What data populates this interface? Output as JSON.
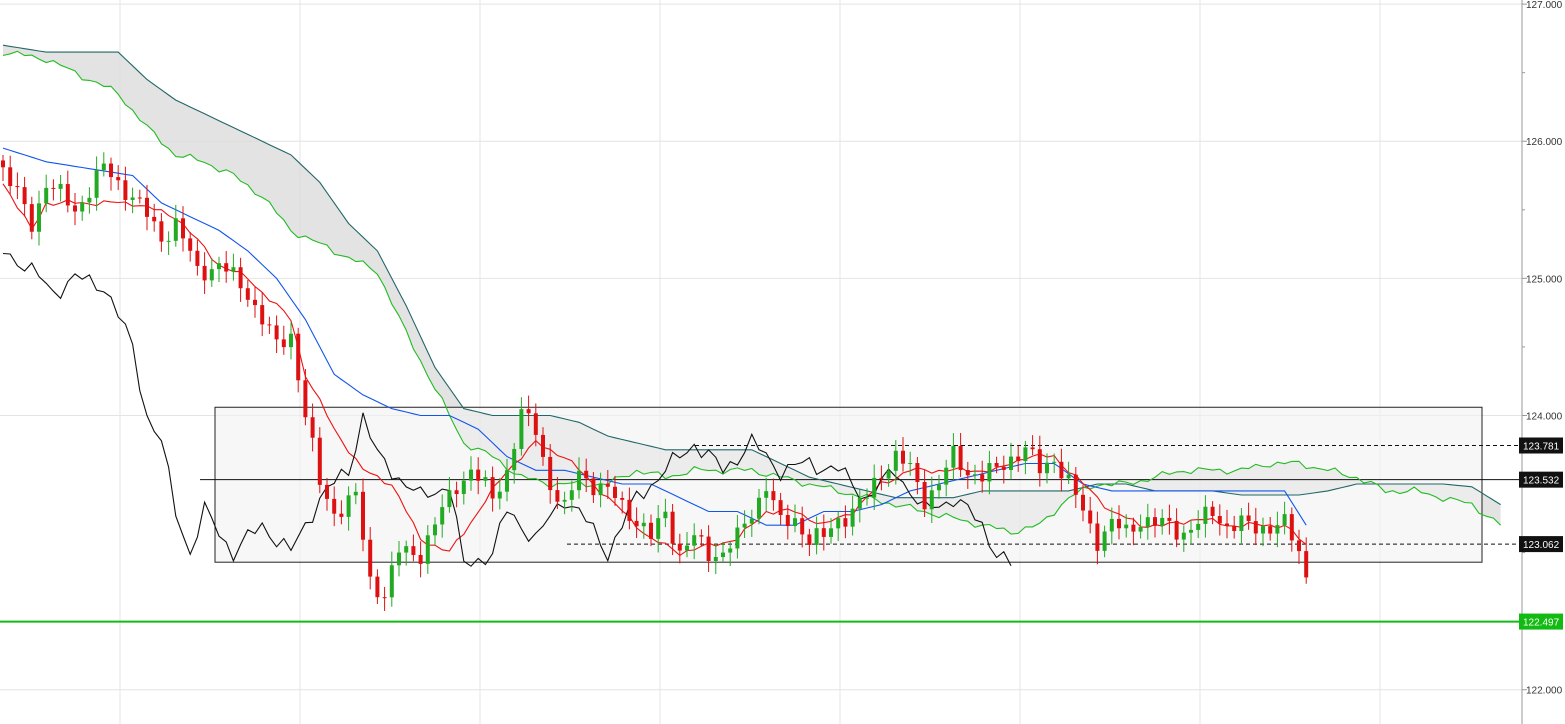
{
  "chart_data": {
    "type": "candlestick",
    "indicator": "ichimoku",
    "y_axis": {
      "min": 121.75,
      "max": 127.03,
      "ticks": [
        122.0,
        122.5,
        123.0,
        123.5,
        124.0,
        124.5,
        125.0,
        125.5,
        126.0,
        126.5,
        127.0
      ],
      "labels": [
        "122.000",
        "",
        "",
        "",
        "124.000",
        "",
        "125.000",
        "",
        "126.000",
        "",
        "127.000"
      ],
      "position": "right"
    },
    "grid": true,
    "colors": {
      "bull": "#22aa22",
      "bear": "#dd1111",
      "tenkan": "#ee1111",
      "kijun": "#1155ee",
      "chikou": "#111111",
      "span_a": "#22bb22",
      "span_b": "#226666",
      "cloud_fill": "#d9d9d9",
      "range_fill": "#f2f2f2",
      "support_line": "#11bb11",
      "label_bg": "#111111",
      "support_label_bg": "#11bb11"
    },
    "levels": [
      {
        "label": "123.781",
        "value": 123.781,
        "style": "dashed",
        "color": "#111111"
      },
      {
        "label": "123.532",
        "value": 123.532,
        "style": "solid",
        "color": "#111111"
      },
      {
        "label": "123.062",
        "value": 123.062,
        "style": "dashed",
        "color": "#111111"
      },
      {
        "label": "122.497",
        "value": 122.497,
        "style": "solid",
        "color": "#11bb11"
      }
    ],
    "range_box": {
      "top": 124.06,
      "bottom": 122.93
    },
    "waypoints": {
      "close": [
        [
          0,
          125.8
        ],
        [
          4,
          125.4
        ],
        [
          6,
          125.7
        ],
        [
          10,
          125.5
        ],
        [
          14,
          125.8
        ],
        [
          18,
          125.6
        ],
        [
          22,
          125.3
        ],
        [
          24,
          125.4
        ],
        [
          27,
          125.05
        ],
        [
          30,
          125.1
        ],
        [
          34,
          124.9
        ],
        [
          36,
          124.7
        ],
        [
          38,
          124.5
        ],
        [
          40,
          124.6
        ],
        [
          42,
          124.0
        ],
        [
          44,
          123.5
        ],
        [
          46,
          123.3
        ],
        [
          49,
          123.4
        ],
        [
          51,
          122.8
        ],
        [
          53,
          122.7
        ],
        [
          55,
          123.0
        ],
        [
          58,
          123.0
        ],
        [
          61,
          123.3
        ],
        [
          63,
          123.5
        ],
        [
          65,
          123.6
        ],
        [
          68,
          123.4
        ],
        [
          70,
          123.6
        ],
        [
          72,
          124.0
        ],
        [
          74,
          123.9
        ],
        [
          76,
          123.5
        ],
        [
          78,
          123.3
        ],
        [
          80,
          123.6
        ],
        [
          82,
          123.5
        ],
        [
          85,
          123.4
        ],
        [
          87,
          123.3
        ],
        [
          90,
          123.1
        ],
        [
          92,
          123.3
        ],
        [
          94,
          123.0
        ],
        [
          96,
          123.1
        ],
        [
          98,
          123.0
        ],
        [
          100,
          123.0
        ],
        [
          102,
          123.1
        ],
        [
          104,
          123.3
        ],
        [
          106,
          123.5
        ],
        [
          108,
          123.2
        ],
        [
          110,
          123.25
        ],
        [
          112,
          123.1
        ],
        [
          114,
          123.1
        ],
        [
          116,
          123.25
        ],
        [
          118,
          123.3
        ],
        [
          120,
          123.4
        ],
        [
          122,
          123.6
        ],
        [
          124,
          123.7
        ],
        [
          126,
          123.6
        ],
        [
          128,
          123.4
        ],
        [
          130,
          123.5
        ],
        [
          132,
          123.7
        ],
        [
          134,
          123.6
        ],
        [
          136,
          123.55
        ],
        [
          138,
          123.6
        ],
        [
          140,
          123.7
        ],
        [
          142,
          123.75
        ],
        [
          144,
          123.6
        ],
        [
          146,
          123.7
        ],
        [
          148,
          123.5
        ],
        [
          150,
          123.3
        ],
        [
          152,
          123.1
        ],
        [
          154,
          123.2
        ],
        [
          156,
          123.15
        ],
        [
          158,
          123.25
        ],
        [
          160,
          123.2
        ],
        [
          162,
          123.2
        ],
        [
          164,
          123.15
        ],
        [
          166,
          123.2
        ],
        [
          168,
          123.3
        ],
        [
          170,
          123.2
        ],
        [
          172,
          123.2
        ],
        [
          174,
          123.18
        ],
        [
          176,
          123.2
        ],
        [
          178,
          123.2
        ],
        [
          180,
          123.0
        ],
        [
          181,
          122.85
        ]
      ],
      "tenkan": [
        [
          0,
          125.7
        ],
        [
          4,
          125.35
        ],
        [
          6,
          125.55
        ],
        [
          12,
          125.55
        ],
        [
          18,
          125.55
        ],
        [
          24,
          125.45
        ],
        [
          30,
          125.1
        ],
        [
          34,
          125.0
        ],
        [
          36,
          124.9
        ],
        [
          40,
          124.7
        ],
        [
          42,
          124.3
        ],
        [
          46,
          123.9
        ],
        [
          50,
          123.6
        ],
        [
          54,
          123.5
        ],
        [
          58,
          123.1
        ],
        [
          62,
          123.0
        ],
        [
          66,
          123.3
        ],
        [
          70,
          123.6
        ],
        [
          74,
          123.8
        ],
        [
          78,
          123.7
        ],
        [
          82,
          123.5
        ],
        [
          86,
          123.3
        ],
        [
          90,
          123.1
        ],
        [
          94,
          123.0
        ],
        [
          98,
          123.05
        ],
        [
          102,
          123.1
        ],
        [
          106,
          123.3
        ],
        [
          110,
          123.3
        ],
        [
          114,
          123.2
        ],
        [
          118,
          123.3
        ],
        [
          122,
          123.5
        ],
        [
          126,
          123.6
        ],
        [
          130,
          123.6
        ],
        [
          134,
          123.6
        ],
        [
          138,
          123.6
        ],
        [
          142,
          123.7
        ],
        [
          146,
          123.7
        ],
        [
          150,
          123.5
        ],
        [
          154,
          123.3
        ],
        [
          158,
          123.2
        ],
        [
          162,
          123.2
        ],
        [
          166,
          123.25
        ],
        [
          170,
          123.2
        ],
        [
          174,
          123.2
        ],
        [
          178,
          123.2
        ],
        [
          181,
          123.05
        ]
      ],
      "kijun": [
        [
          0,
          125.95
        ],
        [
          6,
          125.85
        ],
        [
          12,
          125.8
        ],
        [
          18,
          125.75
        ],
        [
          22,
          125.55
        ],
        [
          26,
          125.45
        ],
        [
          30,
          125.35
        ],
        [
          34,
          125.2
        ],
        [
          38,
          125.0
        ],
        [
          42,
          124.7
        ],
        [
          46,
          124.3
        ],
        [
          50,
          124.15
        ],
        [
          54,
          124.05
        ],
        [
          58,
          124.0
        ],
        [
          62,
          124.0
        ],
        [
          66,
          123.9
        ],
        [
          70,
          123.7
        ],
        [
          74,
          123.6
        ],
        [
          78,
          123.6
        ],
        [
          82,
          123.55
        ],
        [
          86,
          123.5
        ],
        [
          90,
          123.5
        ],
        [
          94,
          123.4
        ],
        [
          98,
          123.3
        ],
        [
          102,
          123.3
        ],
        [
          106,
          123.2
        ],
        [
          110,
          123.2
        ],
        [
          114,
          123.3
        ],
        [
          118,
          123.3
        ],
        [
          122,
          123.35
        ],
        [
          126,
          123.45
        ],
        [
          130,
          123.5
        ],
        [
          134,
          123.55
        ],
        [
          138,
          123.6
        ],
        [
          142,
          123.65
        ],
        [
          146,
          123.65
        ],
        [
          150,
          123.5
        ],
        [
          154,
          123.45
        ],
        [
          158,
          123.45
        ],
        [
          162,
          123.45
        ],
        [
          166,
          123.45
        ],
        [
          170,
          123.45
        ],
        [
          174,
          123.45
        ],
        [
          178,
          123.45
        ],
        [
          181,
          123.2
        ]
      ],
      "chikou": [
        [
          0,
          125.2
        ],
        [
          3,
          125.1
        ],
        [
          7,
          124.9
        ],
        [
          10,
          125.0
        ],
        [
          14,
          124.95
        ],
        [
          18,
          124.5
        ],
        [
          20,
          124.0
        ],
        [
          22,
          123.8
        ],
        [
          24,
          123.3
        ],
        [
          26,
          123.0
        ],
        [
          28,
          123.3
        ],
        [
          32,
          123.0
        ],
        [
          36,
          123.2
        ],
        [
          40,
          123.0
        ],
        [
          44,
          123.4
        ],
        [
          48,
          123.6
        ],
        [
          50,
          124.0
        ],
        [
          52,
          123.7
        ],
        [
          54,
          123.6
        ],
        [
          58,
          123.4
        ],
        [
          62,
          123.5
        ],
        [
          64,
          122.9
        ],
        [
          68,
          123.0
        ],
        [
          70,
          123.3
        ],
        [
          74,
          123.1
        ],
        [
          78,
          123.4
        ],
        [
          80,
          123.3
        ],
        [
          84,
          123.0
        ],
        [
          88,
          123.4
        ],
        [
          92,
          123.6
        ],
        [
          96,
          123.8
        ],
        [
          100,
          123.6
        ],
        [
          104,
          123.8
        ],
        [
          108,
          123.6
        ],
        [
          112,
          123.65
        ],
        [
          116,
          123.6
        ],
        [
          120,
          123.4
        ],
        [
          124,
          123.6
        ],
        [
          128,
          123.3
        ],
        [
          132,
          123.4
        ],
        [
          136,
          123.2
        ],
        [
          138,
          123.0
        ],
        [
          140,
          122.9
        ]
      ],
      "span_a": [
        [
          0,
          126.65
        ],
        [
          6,
          126.6
        ],
        [
          12,
          126.45
        ],
        [
          16,
          126.35
        ],
        [
          20,
          126.1
        ],
        [
          24,
          125.9
        ],
        [
          28,
          125.85
        ],
        [
          32,
          125.75
        ],
        [
          36,
          125.6
        ],
        [
          40,
          125.35
        ],
        [
          44,
          125.25
        ],
        [
          48,
          125.15
        ],
        [
          52,
          125.05
        ],
        [
          56,
          124.6
        ],
        [
          60,
          124.2
        ],
        [
          64,
          123.8
        ],
        [
          68,
          123.7
        ],
        [
          72,
          123.55
        ],
        [
          76,
          123.5
        ],
        [
          80,
          123.5
        ],
        [
          84,
          123.5
        ],
        [
          88,
          123.6
        ],
        [
          92,
          123.55
        ],
        [
          96,
          123.6
        ],
        [
          100,
          123.6
        ],
        [
          104,
          123.6
        ],
        [
          108,
          123.55
        ],
        [
          112,
          123.5
        ],
        [
          116,
          123.45
        ],
        [
          120,
          123.4
        ],
        [
          124,
          123.35
        ],
        [
          128,
          123.3
        ],
        [
          132,
          123.25
        ],
        [
          136,
          123.2
        ],
        [
          140,
          123.15
        ],
        [
          144,
          123.2
        ],
        [
          148,
          123.4
        ],
        [
          152,
          123.5
        ],
        [
          156,
          123.5
        ],
        [
          160,
          123.55
        ],
        [
          164,
          123.6
        ],
        [
          168,
          123.6
        ],
        [
          172,
          123.6
        ],
        [
          176,
          123.65
        ],
        [
          180,
          123.65
        ],
        [
          184,
          123.6
        ],
        [
          188,
          123.55
        ],
        [
          192,
          123.45
        ],
        [
          196,
          123.45
        ],
        [
          200,
          123.4
        ],
        [
          204,
          123.35
        ],
        [
          208,
          123.2
        ]
      ],
      "span_b": [
        [
          0,
          126.7
        ],
        [
          6,
          126.65
        ],
        [
          12,
          126.65
        ],
        [
          16,
          126.65
        ],
        [
          20,
          126.45
        ],
        [
          24,
          126.3
        ],
        [
          28,
          126.2
        ],
        [
          32,
          126.1
        ],
        [
          36,
          126.0
        ],
        [
          40,
          125.9
        ],
        [
          44,
          125.7
        ],
        [
          48,
          125.4
        ],
        [
          52,
          125.2
        ],
        [
          56,
          124.8
        ],
        [
          60,
          124.35
        ],
        [
          64,
          124.05
        ],
        [
          68,
          124.0
        ],
        [
          72,
          124.0
        ],
        [
          76,
          124.0
        ],
        [
          80,
          123.95
        ],
        [
          84,
          123.85
        ],
        [
          88,
          123.8
        ],
        [
          92,
          123.75
        ],
        [
          96,
          123.75
        ],
        [
          100,
          123.75
        ],
        [
          104,
          123.75
        ],
        [
          108,
          123.65
        ],
        [
          112,
          123.55
        ],
        [
          116,
          123.5
        ],
        [
          120,
          123.45
        ],
        [
          124,
          123.4
        ],
        [
          128,
          123.4
        ],
        [
          132,
          123.4
        ],
        [
          136,
          123.45
        ],
        [
          140,
          123.45
        ],
        [
          144,
          123.45
        ],
        [
          148,
          123.45
        ],
        [
          152,
          123.5
        ],
        [
          156,
          123.5
        ],
        [
          160,
          123.45
        ],
        [
          164,
          123.45
        ],
        [
          168,
          123.45
        ],
        [
          172,
          123.42
        ],
        [
          176,
          123.42
        ],
        [
          180,
          123.42
        ],
        [
          184,
          123.45
        ],
        [
          188,
          123.5
        ],
        [
          192,
          123.5
        ],
        [
          196,
          123.5
        ],
        [
          200,
          123.5
        ],
        [
          204,
          123.48
        ],
        [
          208,
          123.35
        ]
      ]
    }
  }
}
